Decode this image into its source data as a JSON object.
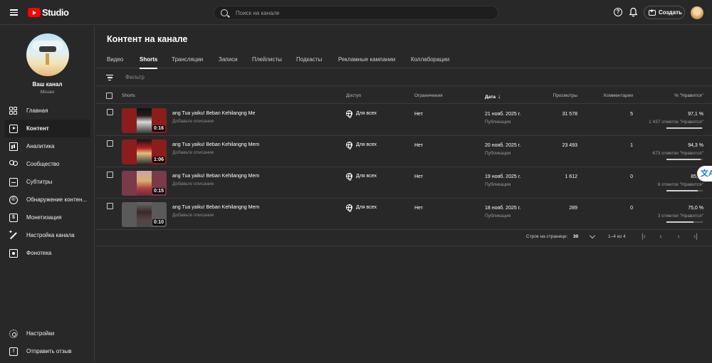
{
  "header": {
    "logo_text": "Studio",
    "search_placeholder": "Поиск на канале",
    "help_glyph": "?",
    "create_label": "Создать"
  },
  "sidebar": {
    "channel_name": "Ваш канал",
    "channel_handle": "Msuao",
    "items": [
      {
        "label": "Главная"
      },
      {
        "label": "Контент"
      },
      {
        "label": "Аналитика"
      },
      {
        "label": "Сообщество"
      },
      {
        "label": "Субтитры"
      },
      {
        "label": "Обнаружение контен..."
      },
      {
        "label": "Монетизация"
      },
      {
        "label": "Настройка канала"
      },
      {
        "label": "Фонотека"
      }
    ],
    "bottom_items": [
      {
        "label": "Настройки"
      },
      {
        "label": "Отправить отзыв"
      }
    ]
  },
  "main": {
    "title": "Контент на канале",
    "tabs": [
      "Видео",
      "Shorts",
      "Трансляции",
      "Записи",
      "Плейлисты",
      "Подкасты",
      "Рекламные кампании",
      "Коллаборации"
    ],
    "active_tab": "Shorts",
    "filter_placeholder": "Фильтр",
    "columns": {
      "shorts": "Shorts",
      "access": "Доступ",
      "restrictions": "Ограничения",
      "date": "Дата",
      "views": "Просмотры",
      "comments": "Комментарии",
      "likes": "% \"Нравится\""
    },
    "rows": [
      {
        "title": "ang Tua yaiku! Beban Kehilangng Me",
        "desc": "Добавьте описание",
        "duration": "0:16",
        "access": "Для всех",
        "restrictions": "Нет",
        "date": "21 нояб. 2025 г.",
        "date_sub": "Публикация",
        "views": "31 578",
        "comments": "5",
        "likes_pct": "97,1 %",
        "likes_sub": "1 437 отметок \"Нравится\"",
        "likes_ratio": 0.971
      },
      {
        "title": "ang Tua yaiku! Beban Kehilangng Mem",
        "desc": "Добавьте описание",
        "duration": "1:06",
        "access": "Для всех",
        "restrictions": "Нет",
        "date": "20 нояб. 2025 г.",
        "date_sub": "Публикация",
        "views": "23 493",
        "comments": "1",
        "likes_pct": "94,3 %",
        "likes_sub": "673 отметки \"Нравится\"",
        "likes_ratio": 0.943
      },
      {
        "title": "ang Tua yaiku! Beban Kehilangng Mem",
        "desc": "Добавьте описание",
        "duration": "0:15",
        "access": "Для всех",
        "restrictions": "Нет",
        "date": "19 нояб. 2025 г.",
        "date_sub": "Публикация",
        "views": "1 612",
        "comments": "0",
        "likes_pct": "85,",
        "likes_sub": "6 отметок \"Нравится\"",
        "likes_ratio": 0.857
      },
      {
        "title": "ang Tua yaiku! Beban Kehilangng Mem",
        "desc": "Добавьте описание",
        "duration": "0:10",
        "access": "Для всех",
        "restrictions": "Нет",
        "date": "18 нояб. 2025 г.",
        "date_sub": "Публикация",
        "views": "289",
        "comments": "0",
        "likes_pct": "75,0 %",
        "likes_sub": "3 отметки \"Нравится\"",
        "likes_ratio": 0.75
      }
    ],
    "pagination": {
      "rows_label": "Строк на странице:",
      "rows_count": "30",
      "range": "1–4 из 4"
    }
  },
  "translate_glyph": "文A",
  "colors": {
    "background": "#282828",
    "accent_red": "#ff0000",
    "divider": "#3a3a3a"
  }
}
